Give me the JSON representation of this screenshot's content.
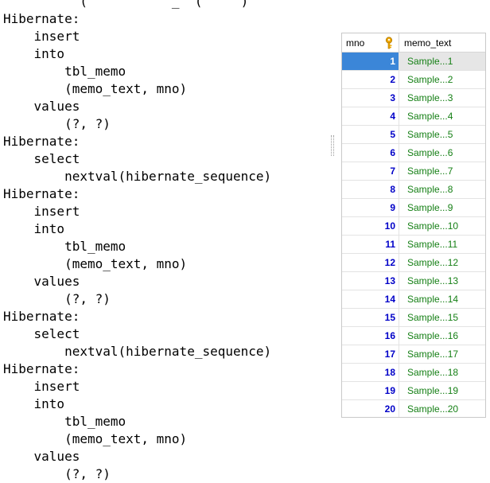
{
  "console": {
    "top_clip": "          (           _  (     )",
    "lines": [
      "Hibernate:",
      "    insert",
      "    into",
      "        tbl_memo",
      "        (memo_text, mno)",
      "    values",
      "        (?, ?)",
      "Hibernate:",
      "    select",
      "        nextval(hibernate_sequence)",
      "Hibernate:",
      "    insert",
      "    into",
      "        tbl_memo",
      "        (memo_text, mno)",
      "    values",
      "        (?, ?)",
      "Hibernate:",
      "    select",
      "        nextval(hibernate_sequence)",
      "Hibernate:",
      "    insert",
      "    into",
      "        tbl_memo",
      "        (memo_text, mno)",
      "    values",
      "        (?, ?)"
    ]
  },
  "grid": {
    "columns": [
      "mno",
      "memo_text"
    ],
    "key_icon": "primary-key-icon",
    "selected_row": 0,
    "colors": {
      "number": "#0000c8",
      "text": "#168016",
      "selected_bg": "#3b86d8"
    },
    "rows": [
      {
        "mno": "1",
        "memo_text": "Sample...1"
      },
      {
        "mno": "2",
        "memo_text": "Sample...2"
      },
      {
        "mno": "3",
        "memo_text": "Sample...3"
      },
      {
        "mno": "4",
        "memo_text": "Sample...4"
      },
      {
        "mno": "5",
        "memo_text": "Sample...5"
      },
      {
        "mno": "6",
        "memo_text": "Sample...6"
      },
      {
        "mno": "7",
        "memo_text": "Sample...7"
      },
      {
        "mno": "8",
        "memo_text": "Sample...8"
      },
      {
        "mno": "9",
        "memo_text": "Sample...9"
      },
      {
        "mno": "10",
        "memo_text": "Sample...10"
      },
      {
        "mno": "11",
        "memo_text": "Sample...11"
      },
      {
        "mno": "12",
        "memo_text": "Sample...12"
      },
      {
        "mno": "13",
        "memo_text": "Sample...13"
      },
      {
        "mno": "14",
        "memo_text": "Sample...14"
      },
      {
        "mno": "15",
        "memo_text": "Sample...15"
      },
      {
        "mno": "16",
        "memo_text": "Sample...16"
      },
      {
        "mno": "17",
        "memo_text": "Sample...17"
      },
      {
        "mno": "18",
        "memo_text": "Sample...18"
      },
      {
        "mno": "19",
        "memo_text": "Sample...19"
      },
      {
        "mno": "20",
        "memo_text": "Sample...20"
      }
    ]
  }
}
